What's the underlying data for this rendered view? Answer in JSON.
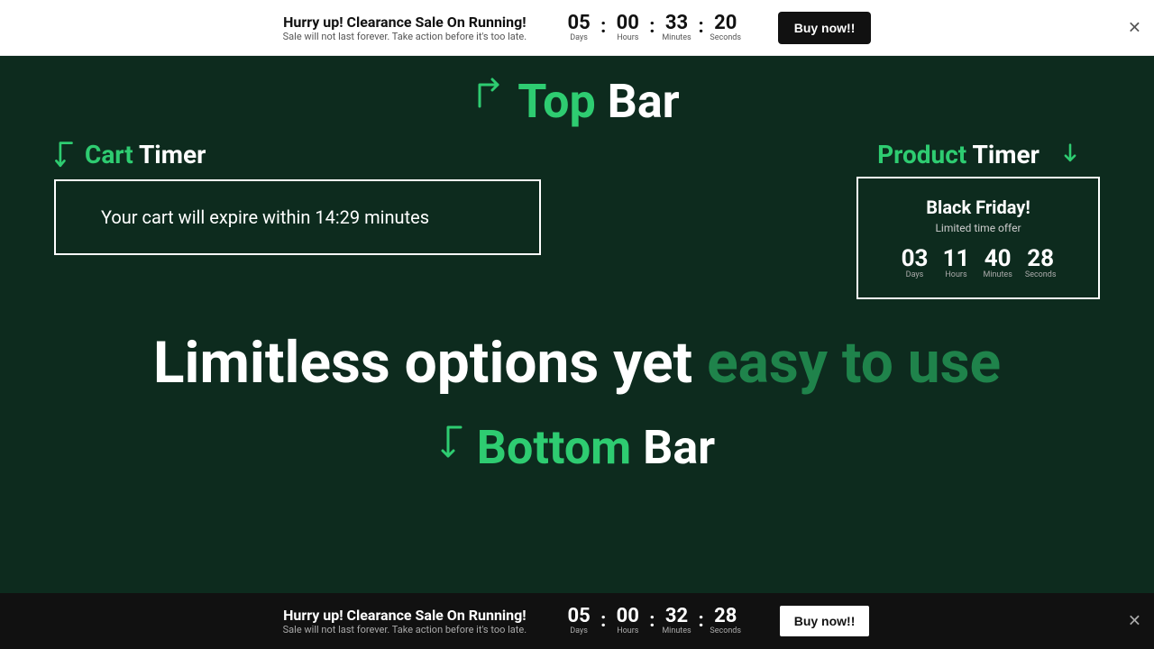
{
  "topBar": {
    "title": "Hurry up! Clearance Sale On Running!",
    "subtitle": "Sale will not last forever. Take action before it's too late.",
    "countdown": {
      "days": "05",
      "hours": "00",
      "minutes": "33",
      "seconds": "20",
      "days_label": "Days",
      "hours_label": "Hours",
      "minutes_label": "Minutes",
      "seconds_label": "Seconds"
    },
    "buy_button": "Buy now!!"
  },
  "bottomBar": {
    "title": "Hurry up! Clearance Sale On Running!",
    "subtitle": "Sale will not last forever. Take action before it's too late.",
    "countdown": {
      "days": "05",
      "hours": "00",
      "minutes": "32",
      "seconds": "28",
      "days_label": "Days",
      "hours_label": "Hours",
      "minutes_label": "Minutes",
      "seconds_label": "Seconds"
    },
    "buy_button": "Buy now!!"
  },
  "mainContent": {
    "topBarLabel": {
      "green": "Top",
      "white": " Bar"
    },
    "cartTimer": {
      "label_green": "Cart",
      "label_white": " Timer",
      "box_text": "Your cart  will expire within 14:29 minutes"
    },
    "productTimer": {
      "label_green": "Product",
      "label_white": " Timer",
      "box_title": "Black Friday!",
      "box_sub": "Limited time offer",
      "countdown": {
        "days": "03",
        "hours": "11",
        "minutes": "40",
        "seconds": "28",
        "days_label": "Days",
        "hours_label": "Hours",
        "minutes_label": "Minutes",
        "seconds_label": "Seconds"
      }
    },
    "limitless": {
      "line1_white": "Limitless options yet ",
      "line1_muted": "easy to use"
    },
    "bottomBarLabel": {
      "green": "Bottom",
      "white": " Bar"
    }
  }
}
